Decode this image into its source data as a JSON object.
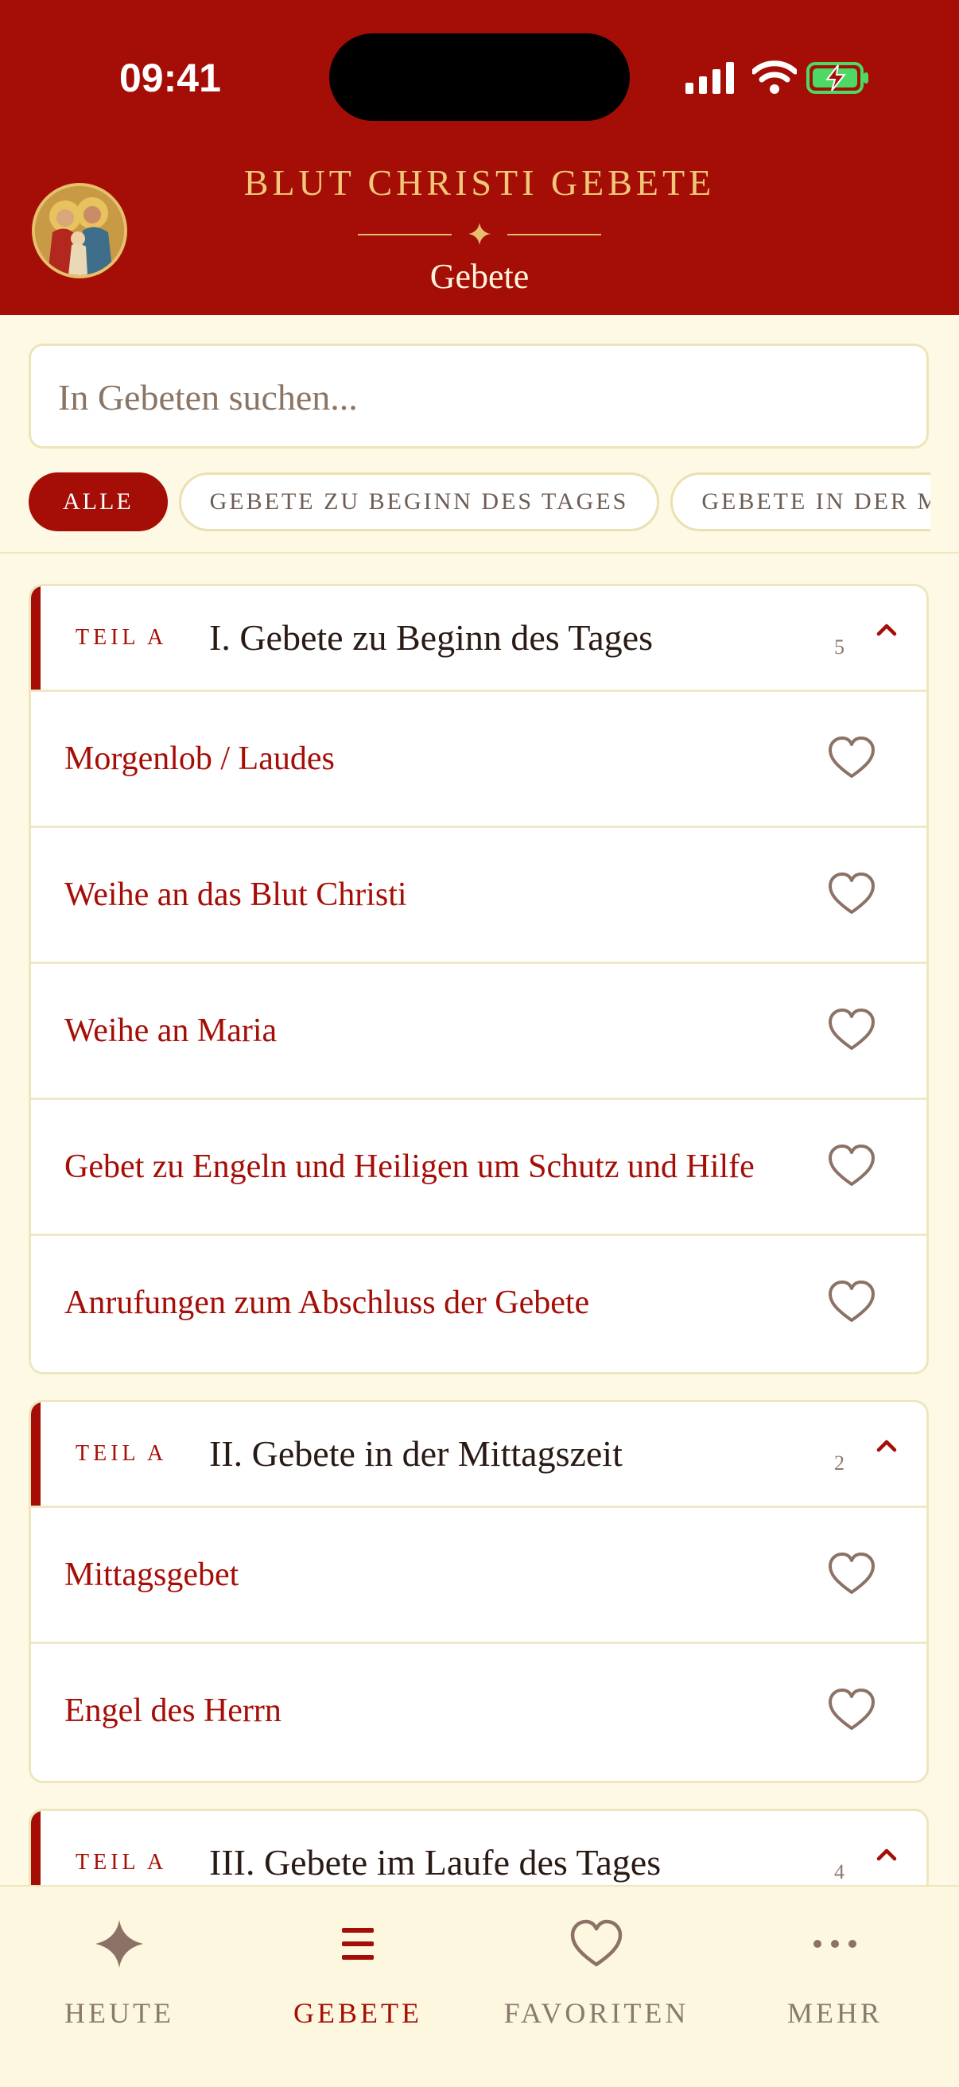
{
  "status_bar": {
    "time": "09:41"
  },
  "header": {
    "app_title": "BLUT CHRISTI GEBETE",
    "page_title": "Gebete",
    "avatar_icon": "holy-family-icon",
    "accent_color": "#A50E06",
    "gold_color": "#F1C879"
  },
  "search": {
    "placeholder": "In Gebeten suchen..."
  },
  "filters": {
    "chips": [
      {
        "label": "ALLE",
        "active": true
      },
      {
        "label": "GEBETE ZU BEGINN DES TAGES",
        "active": false
      },
      {
        "label": "GEBETE IN DER MITTAGSZEIT",
        "active": false
      }
    ]
  },
  "sections": [
    {
      "tag": "TEIL A",
      "title": "I. Gebete zu Beginn des Tages",
      "count": "5",
      "items": [
        {
          "title": "Morgenlob / Laudes"
        },
        {
          "title": "Weihe an das Blut Christi"
        },
        {
          "title": "Weihe an Maria"
        },
        {
          "title": "Gebet zu Engeln und Heiligen um Schutz und Hilfe"
        },
        {
          "title": "Anrufungen zum Abschluss der Gebete"
        }
      ]
    },
    {
      "tag": "TEIL A",
      "title": "II. Gebete in der Mittagszeit",
      "count": "2",
      "items": [
        {
          "title": "Mittagsgebet"
        },
        {
          "title": "Engel des Herrn"
        }
      ]
    },
    {
      "tag": "TEIL A",
      "title": "III. Gebete im Laufe des Tages",
      "count": "4",
      "items": []
    }
  ],
  "bottom_nav": {
    "items": [
      {
        "label": "HEUTE",
        "icon": "sparkle-icon",
        "active": false
      },
      {
        "label": "GEBETE",
        "icon": "menu-lines-icon",
        "active": true
      },
      {
        "label": "FAVORITEN",
        "icon": "heart-icon",
        "active": false
      },
      {
        "label": "MEHR",
        "icon": "more-dots-icon",
        "active": false
      }
    ]
  }
}
